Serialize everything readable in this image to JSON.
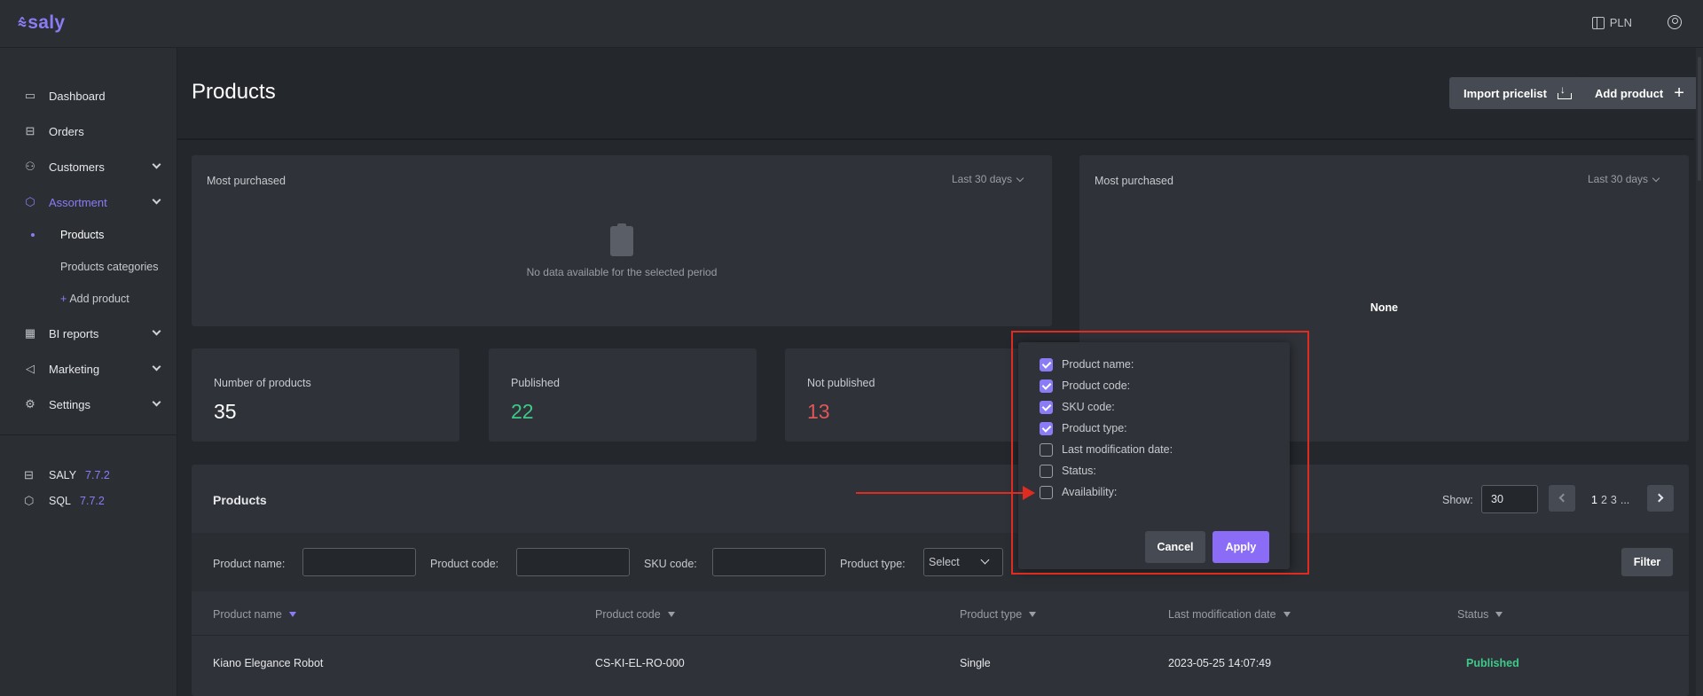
{
  "app": {
    "logo": "saly",
    "currency": "PLN"
  },
  "sidebar": {
    "items": [
      {
        "label": "Dashboard"
      },
      {
        "label": "Orders"
      },
      {
        "label": "Customers"
      },
      {
        "label": "Assortment"
      },
      {
        "label": "BI reports"
      },
      {
        "label": "Marketing"
      },
      {
        "label": "Settings"
      }
    ],
    "subitems": [
      {
        "label": "Products"
      },
      {
        "label": "Products categories"
      },
      {
        "label": "Add product",
        "prefix": "+"
      }
    ],
    "versions": [
      {
        "name": "SALY",
        "version": "7.7.2"
      },
      {
        "name": "SQL",
        "version": "7.7.2"
      }
    ]
  },
  "header": {
    "title": "Products",
    "import_label": "Import pricelist",
    "add_label": "Add product"
  },
  "cards": {
    "left": {
      "title": "Most purchased",
      "range": "Last 30 days",
      "empty": "No data available for the selected period"
    },
    "right": {
      "title": "Most purchased",
      "range": "Last 30 days",
      "value": "None"
    }
  },
  "stats": [
    {
      "label": "Number of products",
      "value": "35",
      "color": "#ffffff"
    },
    {
      "label": "Published",
      "value": "22",
      "color": "#3ec98a"
    },
    {
      "label": "Not published",
      "value": "13",
      "color": "#e05757"
    }
  ],
  "products": {
    "title": "Products",
    "show_label": "Show:",
    "show_value": "30",
    "pages": [
      "1",
      "2",
      "3",
      "..."
    ],
    "filters": {
      "product_name": "Product name:",
      "product_code": "Product code:",
      "sku_code": "SKU code:",
      "product_type": "Product type:",
      "select_placeholder": "Select",
      "filter_button": "Filter"
    },
    "columns": [
      "Product name",
      "Product code",
      "Product type",
      "Last modification date",
      "Status"
    ],
    "rows": [
      {
        "name": "Kiano Elegance Robot",
        "code": "CS-KI-EL-RO-000",
        "type": "Single",
        "modified": "2023-05-25 14:07:49",
        "status": "Published"
      }
    ]
  },
  "column_picker": {
    "options": [
      {
        "label": "Product name:",
        "checked": true
      },
      {
        "label": "Product code:",
        "checked": true
      },
      {
        "label": "SKU code:",
        "checked": true
      },
      {
        "label": "Product type:",
        "checked": true
      },
      {
        "label": "Last modification date:",
        "checked": false
      },
      {
        "label": "Status:",
        "checked": false
      },
      {
        "label": "Availability:",
        "checked": false
      }
    ],
    "cancel_label": "Cancel",
    "apply_label": "Apply"
  },
  "colors": {
    "accent": "#8b7cf6",
    "annotation": "#e02b20"
  }
}
